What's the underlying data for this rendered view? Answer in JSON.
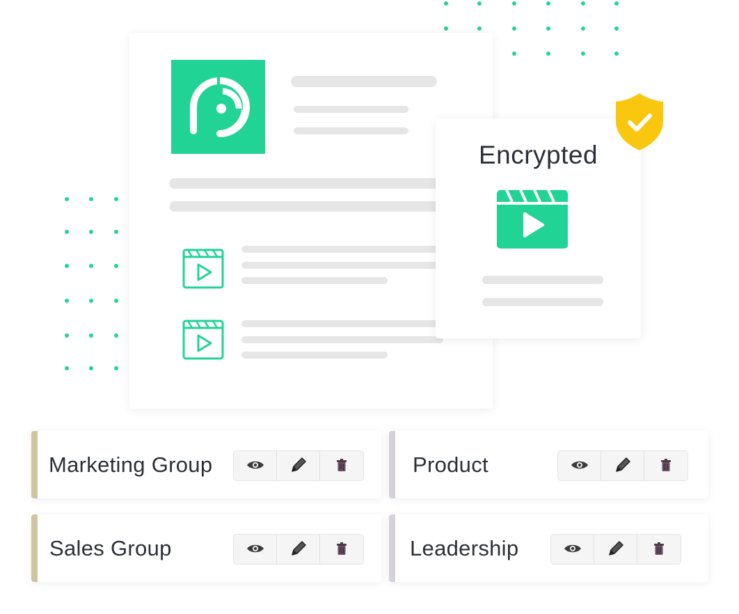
{
  "colors": {
    "accent": "#22d396",
    "shield": "#f9c80e",
    "group_edge_left": "#cdc6a1",
    "group_edge_right": "#d6d2db"
  },
  "encrypted_card": {
    "title": "Encrypted",
    "icons": [
      "shield-check-icon",
      "video-clapper-icon"
    ]
  },
  "groups": [
    {
      "name": "Marketing Group",
      "actions": [
        "eye-icon",
        "pencil-icon",
        "trash-icon"
      ]
    },
    {
      "name": "Product",
      "actions": [
        "eye-icon",
        "pencil-icon",
        "trash-icon"
      ]
    },
    {
      "name": "Sales Group",
      "actions": [
        "eye-icon",
        "pencil-icon",
        "trash-icon"
      ]
    },
    {
      "name": "Leadership",
      "actions": [
        "eye-icon",
        "pencil-icon",
        "trash-icon"
      ]
    }
  ]
}
